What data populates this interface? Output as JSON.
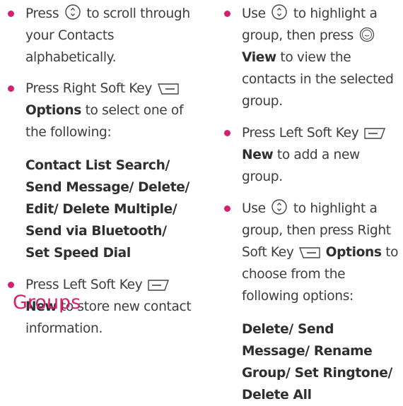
{
  "left": {
    "b1": {
      "pre": "Press",
      "post": "to scroll through your Contacts alphabetically."
    },
    "b2": {
      "pre": "Press Right Soft Key",
      "strong": "Options",
      "post": "to select one of the following:"
    },
    "b2_options": "Contact List Search/ Send Message/ Delete/ Edit/ Delete Multiple/ Send via Bluetooth/ Set Speed Dial",
    "b3": {
      "pre": "Press Left Soft Key",
      "strong": "New",
      "post": "to store new contact information."
    },
    "heading": "Groups"
  },
  "right": {
    "b1": {
      "pre": "Use",
      "mid": "to highlight a group, then press",
      "strong": "View",
      "post": "to view the contacts in the selected group."
    },
    "b2": {
      "pre": "Press Left Soft Key",
      "strong": "New",
      "post": "to add a new group."
    },
    "b3": {
      "pre": "Use",
      "mid": "to highlight a group, then press Right Soft Key",
      "strong": "Options",
      "post": "to choose from the following options:"
    },
    "b3_options": "Delete/ Send Message/ Rename Group/ Set Ringtone/ Delete All"
  },
  "colors": {
    "accent": "#d4206f",
    "text": "#3d3d3d"
  },
  "icons": [
    "nav-key-icon",
    "right-soft-key-icon",
    "left-soft-key-icon",
    "ok-menu-key-icon"
  ]
}
